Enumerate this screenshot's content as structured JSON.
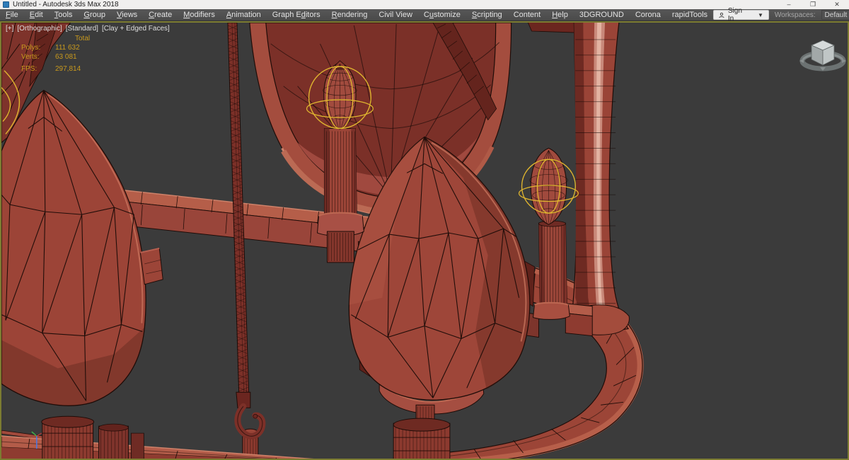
{
  "window": {
    "title": "Untitled - Autodesk 3ds Max 2018",
    "controls": [
      {
        "name": "minimize",
        "glyph": "–"
      },
      {
        "name": "maximize",
        "glyph": "❐"
      },
      {
        "name": "close",
        "glyph": "✕"
      }
    ]
  },
  "menubar": {
    "items": [
      {
        "label": "File",
        "u": 0
      },
      {
        "label": "Edit",
        "u": 0
      },
      {
        "label": "Tools",
        "u": 0
      },
      {
        "label": "Group",
        "u": 0
      },
      {
        "label": "Views",
        "u": 0
      },
      {
        "label": "Create",
        "u": 0
      },
      {
        "label": "Modifiers",
        "u": 0
      },
      {
        "label": "Animation",
        "u": 0
      },
      {
        "label": "Graph Editors",
        "u": 7
      },
      {
        "label": "Rendering",
        "u": 0
      },
      {
        "label": "Civil View",
        "u": -1
      },
      {
        "label": "Customize",
        "u": 1
      },
      {
        "label": "Scripting",
        "u": 0
      },
      {
        "label": "Content",
        "u": -1
      },
      {
        "label": "Help",
        "u": 0
      },
      {
        "label": "3DGROUND",
        "u": -1
      },
      {
        "label": "Corona",
        "u": -1
      },
      {
        "label": "rapidTools",
        "u": -1
      }
    ],
    "sign_in": "Sign In",
    "workspaces_label": "Workspaces:",
    "workspace_value": "Default"
  },
  "viewport": {
    "label_segments": [
      "[+]",
      "[Orthographic]",
      "[Standard]",
      "[Clay + Edged Faces]"
    ],
    "stats": {
      "header": "Total",
      "rows": [
        {
          "label": "Polys:",
          "value": "111 632"
        },
        {
          "label": "Verts:",
          "value": "63 081"
        },
        {
          "label": "FPS:",
          "value": "297,814"
        }
      ]
    },
    "colors": {
      "background": "#3b3b3b",
      "border": "#7c7c31",
      "clay_base": "#9c4538",
      "clay_light": "#b75f4a",
      "clay_dark": "#6e2a22",
      "edge": "#1e0c08",
      "gizmo": "#dfb52f",
      "stats_text": "#c8991d",
      "label_text": "#dedede"
    },
    "scene": {
      "objects": [
        "chandelier ring",
        "teardrop ornaments",
        "candle bulbs with rotation gizmos",
        "hanging rope with hook",
        "view cube"
      ]
    }
  }
}
